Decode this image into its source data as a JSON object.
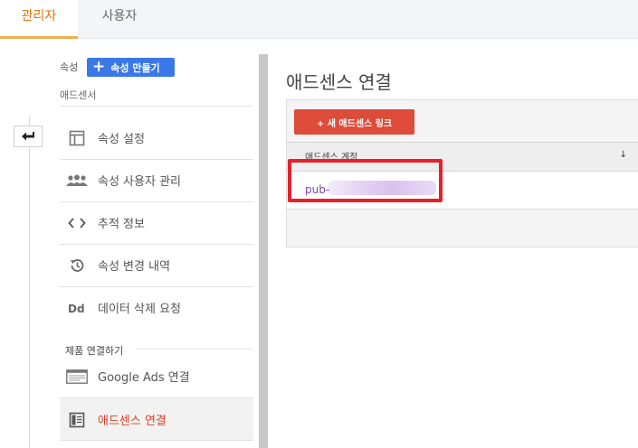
{
  "tabs": {
    "admin": "관리자",
    "user": "사용자"
  },
  "sidebar": {
    "property_label": "속성",
    "create_button": "속성 만들기",
    "create_icon": "plus-icon",
    "adsense_label": "애드센서",
    "items": [
      {
        "label": "속성 설정",
        "icon": "property-settings-icon"
      },
      {
        "label": "속성 사용자 관리",
        "icon": "users-icon"
      },
      {
        "label": "추적 정보",
        "icon": "code-brackets-icon"
      },
      {
        "label": "속성 변경 내역",
        "icon": "history-icon"
      },
      {
        "label": "데이터 삭제 요청",
        "icon": "dd-icon"
      }
    ],
    "section_label": "제품 연결하기",
    "link_items": [
      {
        "label": "Google Ads 연결",
        "icon": "google-ads-icon"
      },
      {
        "label": "애드센스 연결",
        "icon": "adsense-icon",
        "active": true
      }
    ]
  },
  "main": {
    "title": "애드센스 연결",
    "new_link_button": "+ 새 애드센스 링크",
    "table": {
      "column_header": "애드센스 계정",
      "sort_icon": "sort-down-icon",
      "rows": [
        {
          "account": "pub-"
        }
      ]
    }
  },
  "colors": {
    "accent_orange": "#e8710a",
    "primary_blue": "#3b78e7",
    "button_red": "#dd4b39",
    "highlight_red": "#e8202a",
    "link_purple": "#7b3fb0"
  }
}
